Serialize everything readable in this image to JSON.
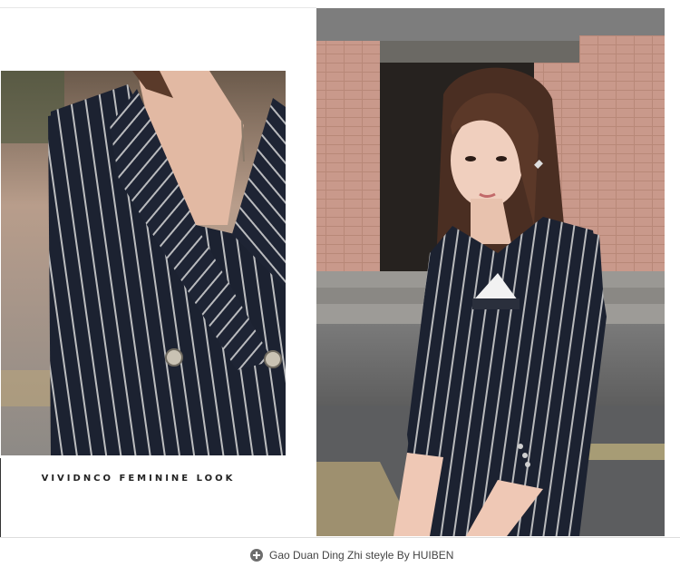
{
  "caption": "VIVIDNCO FEMININE LOOK",
  "footer": {
    "icon": "plus-circle-icon",
    "text": "Gao Duan Ding Zhi steyle By HUIBEN"
  },
  "colors": {
    "jacket": "#1c2231",
    "stripe": "#d8d8d8",
    "brick": "#c9998b"
  }
}
